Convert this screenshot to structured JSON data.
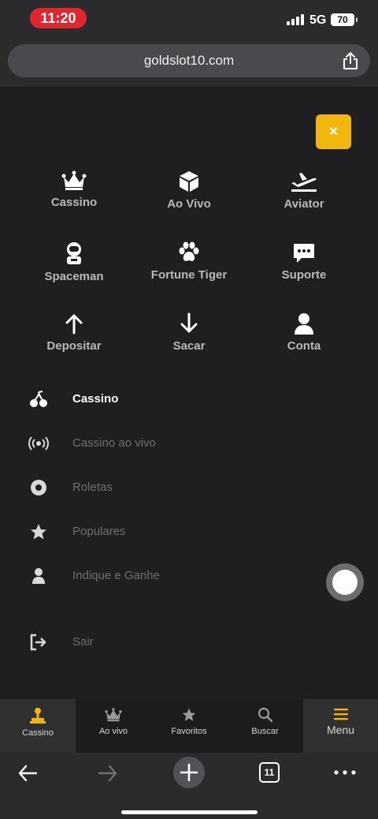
{
  "status_bar": {
    "time": "11:20",
    "network": "5G",
    "battery": "70"
  },
  "browser": {
    "url": "goldslot10.com",
    "tabs_count": "11"
  },
  "close_label": "×",
  "grid": [
    {
      "label": "Cassino",
      "icon": "crown-icon"
    },
    {
      "label": "Ao Vivo",
      "icon": "cube-icon"
    },
    {
      "label": "Aviator",
      "icon": "airplane-icon"
    },
    {
      "label": "Spaceman",
      "icon": "astronaut-icon"
    },
    {
      "label": "Fortune Tiger",
      "icon": "paw-icon"
    },
    {
      "label": "Suporte",
      "icon": "chat-icon"
    },
    {
      "label": "Depositar",
      "icon": "arrow-up-icon"
    },
    {
      "label": "Sacar",
      "icon": "arrow-down-icon"
    },
    {
      "label": "Conta",
      "icon": "user-icon"
    }
  ],
  "menu": [
    {
      "label": "Cassino",
      "icon": "cherries-icon",
      "active": true
    },
    {
      "label": "Cassino ao vivo",
      "icon": "broadcast-icon",
      "active": false
    },
    {
      "label": "Roletas",
      "icon": "roulette-icon",
      "active": false
    },
    {
      "label": "Populares",
      "icon": "star-icon",
      "active": false
    },
    {
      "label": "Indique e Ganhe",
      "icon": "user-icon",
      "active": false
    },
    {
      "label": "Sair",
      "icon": "logout-icon",
      "active": false
    }
  ],
  "bottom_nav": [
    {
      "label": "Cassino",
      "icon": "joystick-icon"
    },
    {
      "label": "Ao vivo",
      "icon": "crown-icon"
    },
    {
      "label": "Favoritos",
      "icon": "star-icon"
    },
    {
      "label": "Buscar",
      "icon": "search-icon"
    },
    {
      "label": "Menu",
      "icon": "hamburger-icon"
    }
  ],
  "colors": {
    "accent": "#f2b70c",
    "background": "#1f1f21",
    "status_time": "#e0262e"
  }
}
